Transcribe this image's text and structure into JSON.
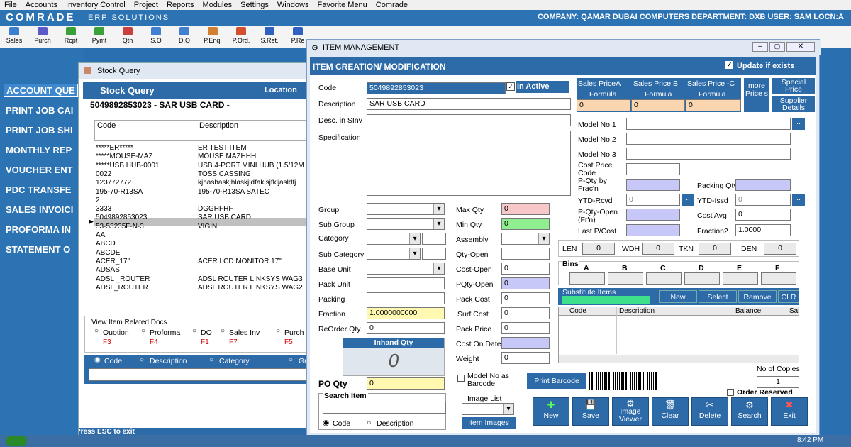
{
  "menubar": [
    "File",
    "Accounts",
    "Inventory Control",
    "Project",
    "Reports",
    "Modules",
    "Settings",
    "Windows",
    "Favorite Menu",
    "Comrade"
  ],
  "app": {
    "title": "COMRADE",
    "subtitle": "ERP SOLUTIONS",
    "company_info": "COMPANY: QAMAR DUBAI COMPUTERS    DEPARTMENT: DXB  USER: SAM LOCN:A"
  },
  "toolbar": [
    "Sales",
    "Purch",
    "Rcpt",
    "Pymt",
    "Qtn",
    "S.O",
    "D.O",
    "P.Enq.",
    "P.Ord.",
    "S.Ret.",
    "P.Re"
  ],
  "leftmenu": [
    "ACCOUNT QUE",
    "PRINT JOB CAI",
    "PRINT JOB SHI",
    "MONTHLY REP",
    "VOUCHER ENT",
    "PDC TRANSFE",
    "SALES INVOICI",
    "PROFORMA IN",
    "STATEMENT O"
  ],
  "stock": {
    "window_title": "Stock Query",
    "header": "Stock Query",
    "location_label": "Location",
    "selected_item": "5049892853023 - SAR USB CARD -",
    "col_code": "Code",
    "col_desc": "Description",
    "rows": [
      {
        "code": "*****ER*****",
        "desc": "ER TEST ITEM"
      },
      {
        "code": "*****MOUSE-MAZ",
        "desc": "MOUSE MAZHHH"
      },
      {
        "code": "*****USB HUB-0001",
        "desc": "USB 4-PORT MINI HUB (1.5/12M"
      },
      {
        "code": "0022",
        "desc": "TOSS CASSING"
      },
      {
        "code": "123772772",
        "desc": "kjhashaskjhlaskjldfaklsjfkljasldfj"
      },
      {
        "code": "195-70-R13SA",
        "desc": "195-70-R13SA      SATEC"
      },
      {
        "code": "2",
        "desc": ""
      },
      {
        "code": "3333",
        "desc": "DGGHFHF"
      },
      {
        "code": "5049892853023",
        "desc": "SAR USB CARD"
      },
      {
        "code": "53-53235F-N-3",
        "desc": "VIGIN"
      },
      {
        "code": "AA",
        "desc": ""
      },
      {
        "code": "ABCD",
        "desc": ""
      },
      {
        "code": "ABCDE",
        "desc": ""
      },
      {
        "code": "ACER_17\"",
        "desc": "ACER LCD MONITOR 17\""
      },
      {
        "code": "ADSAS",
        "desc": ""
      },
      {
        "code": "ADSL _ROUTER",
        "desc": "ADSL ROUTER LINKSYS WAG3"
      },
      {
        "code": "ADSL_ROUTER",
        "desc": "ADSL ROUTER LINKSYS WAG2"
      }
    ],
    "view_docs_label": "View Item Related Docs",
    "docs": [
      {
        "label": "Quotion",
        "key": "F3"
      },
      {
        "label": "Proforma",
        "key": "F4"
      },
      {
        "label": "DO",
        "key": "F1"
      },
      {
        "label": "Sales Inv",
        "key": "F7"
      },
      {
        "label": "Purch",
        "key": "F5"
      }
    ],
    "search_opts": [
      "Code",
      "Description",
      "Category",
      "Gr"
    ],
    "esc_hint": "Press ESC to exit"
  },
  "item": {
    "window_title": "ITEM MANAGEMENT",
    "header": "ITEM CREATION/ MODIFICATION",
    "update_label": "Update if exists",
    "code_label": "Code",
    "code_value": "5049892853023",
    "inactive_label": "In Active",
    "desc_label": "Description",
    "desc_value": "SAR USB CARD",
    "descinv_label": "Desc. in SInv",
    "spec_label": "Specification",
    "sales_a": "Sales PriceA",
    "sales_b": "Sales Price B",
    "sales_c": "Sales Price -C",
    "formula": "Formula",
    "price_a": "0",
    "price_b": "0",
    "price_c": "0",
    "more_price": "more Price s",
    "special_price": "Special Price",
    "supplier_details": "Supplier Details",
    "model1": "Model No 1",
    "model2": "Model No 2",
    "model3": "Model No 3",
    "cost_price_code": "Cost Price Code",
    "pqty_frac": "P-Qty by Frac'n",
    "packing_qty": "Packing Qty",
    "ytd_rcvd": "YTD-Rcvd",
    "ytd_rcvd_val": "0",
    "ytd_issd": "YTD-Issd",
    "ytd_issd_val": "0",
    "pqty_open": "P-Qty-Open (Fr'n)",
    "cost_avg": "Cost Avg",
    "cost_avg_val": "0",
    "last_pcost": "Last P/Cost",
    "fraction2": "Fraction2",
    "fraction2_val": "1.0000",
    "len": "LEN",
    "wdh": "WDH",
    "tkn": "TKN",
    "den": "DEN",
    "len_v": "0",
    "wdh_v": "0",
    "tkn_v": "0",
    "den_v": "0",
    "bins_label": "Bins",
    "bins": [
      "A",
      "B",
      "C",
      "D",
      "E",
      "F"
    ],
    "substitute": "Substitute Items",
    "sub_new": "New",
    "sub_select": "Select",
    "sub_remove": "Remove",
    "sub_clr": "CLR",
    "sub_col_code": "Code",
    "sub_col_desc": "Description",
    "sub_col_bal": "Balance",
    "sub_col_sal": "Sal",
    "group": "Group",
    "subgroup": "Sub Group",
    "category": "Category",
    "subcategory": "Sub Category",
    "baseunit": "Base Unit",
    "packunit": "Pack Unit",
    "packing": "Packing",
    "fraction": "Fraction",
    "fraction_val": "1.0000000000",
    "reorder": "ReOrder Qty",
    "reorder_val": "0",
    "maxqty": "Max Qty",
    "maxqty_val": "0",
    "minqty": "Min Qty",
    "minqty_val": "0",
    "assembly": "Assembly",
    "qtyopen": "Qty-Open",
    "costopen": "Cost-Open",
    "costopen_val": "0",
    "pqtyopen": "PQty-Open",
    "pqtyopen_val": "0",
    "packcost": "Pack Cost",
    "packcost_val": "0",
    "surfcost": "Surf Cost",
    "surfcost_val": "0",
    "packprice": "Pack Price",
    "packprice_val": "0",
    "costondate": "Cost On Date",
    "weight": "Weight",
    "weight_val": "0",
    "inhand": "Inhand Qty",
    "inhand_val": "0",
    "poqty": "PO Qty",
    "poqty_val": "0",
    "search_item": "Search Item",
    "search_code": "Code",
    "search_desc": "Description",
    "model_barcode": "Model No as Barcode",
    "image_list": "Image List",
    "item_images": "Item Images",
    "print_barcode": "Print Barcode",
    "copies_label": "No of Copies",
    "copies_val": "1",
    "order_reserved": "Order Reserved",
    "btn_new": "New",
    "btn_save": "Save",
    "btn_viewer": "Image Viewer",
    "btn_clear": "Clear",
    "btn_delete": "Delete",
    "btn_search": "Search",
    "btn_exit": "Exit"
  },
  "clock": "8:42 PM",
  "colors": {
    "brand": "#2c6aa8",
    "pink": "#f8c8c8",
    "green": "#90ee90",
    "lavender": "#c8c8f8",
    "yellow": "#fff8b0",
    "peach": "#fad6b0"
  }
}
